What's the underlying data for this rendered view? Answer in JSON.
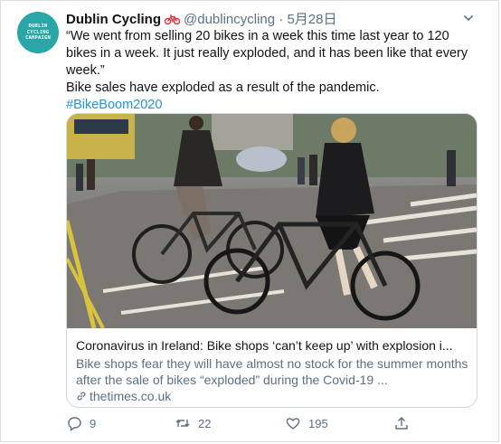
{
  "avatar": {
    "lines": [
      "DUBLIN",
      "CYCLING",
      "CAMPAIGN"
    ]
  },
  "user": {
    "display_name": "Dublin Cycling",
    "handle": "@dublincycling",
    "separator": "·",
    "date": "5月28日"
  },
  "tweet": {
    "quote": "“We went from selling 20 bikes in a week this time last year to 120 bikes in a week. It just really exploded, and it has been like that every week.”",
    "line2": "Bike sales have exploded as a result of the pandemic.",
    "hashtag": "#BikeBoom2020"
  },
  "card": {
    "title": "Coronavirus in Ireland: Bike shops ‘can’t keep up’ with explosion i...",
    "description": "Bike shops fear they will have almost no stock for the summer months after the sale of bikes “exploded” during the Covid-19 ...",
    "domain": "thetimes.co.uk"
  },
  "actions": {
    "replies": "9",
    "retweets": "22",
    "likes": "195"
  },
  "colors": {
    "accent": "#1b95e0",
    "muted": "#5b7083",
    "avatar_bg": "#2aa6a8"
  }
}
